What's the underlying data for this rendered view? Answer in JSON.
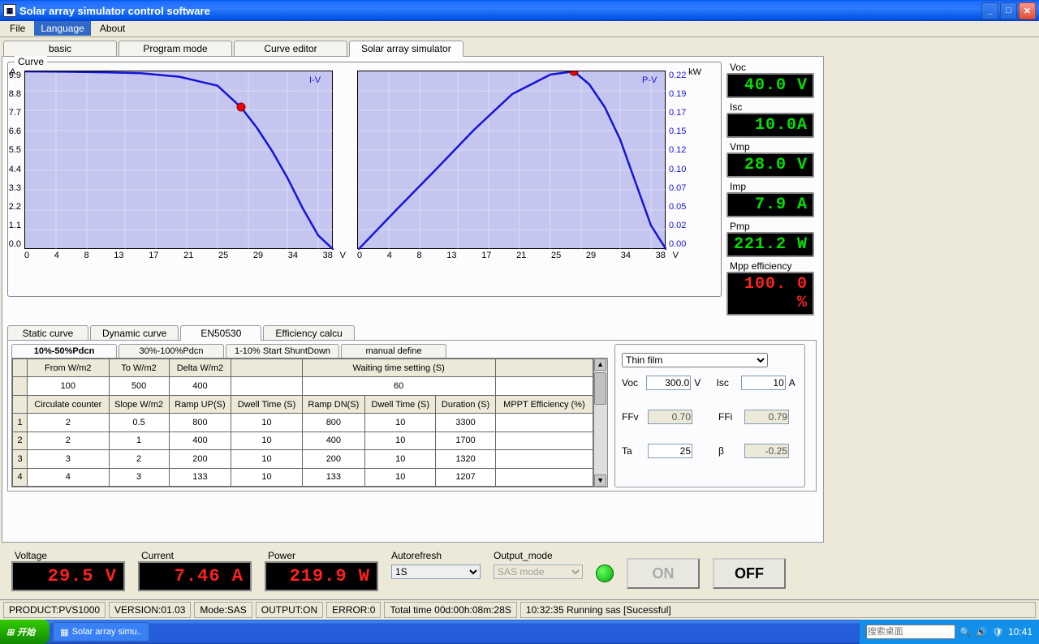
{
  "window": {
    "title": "Solar array simulator control software"
  },
  "menu": {
    "file": "File",
    "language": "Language",
    "about": "About"
  },
  "maintabs": {
    "basic": "basic",
    "program": "Program mode",
    "curve": "Curve editor",
    "sas": "Solar array simulator"
  },
  "curve": {
    "title": "Curve",
    "iv_label": "I-V",
    "pv_label": "P-V",
    "xunit": "V",
    "yunit_iv": "A",
    "yunit_pv": "kW"
  },
  "chart_data": [
    {
      "type": "line",
      "name": "I-V",
      "xlabel": "V",
      "ylabel": "A",
      "xlim": [
        0,
        40
      ],
      "ylim": [
        0,
        9.9
      ],
      "x_ticks": [
        0,
        4,
        8,
        13,
        17,
        21,
        25,
        29,
        34,
        38
      ],
      "y_ticks": [
        0.0,
        1.1,
        2.2,
        3.3,
        4.4,
        5.5,
        6.6,
        7.7,
        8.8,
        9.9
      ],
      "x": [
        0,
        5,
        10,
        15,
        20,
        25,
        28,
        30,
        32,
        34,
        36,
        38,
        40
      ],
      "y": [
        9.9,
        9.88,
        9.85,
        9.8,
        9.6,
        9.1,
        7.9,
        6.8,
        5.5,
        4.0,
        2.3,
        0.8,
        0.0
      ],
      "marker": {
        "x": 28,
        "y": 7.9
      }
    },
    {
      "type": "line",
      "name": "P-V",
      "xlabel": "V",
      "ylabel": "kW",
      "xlim": [
        0,
        40
      ],
      "ylim": [
        0,
        0.22
      ],
      "x_ticks": [
        0,
        4,
        8,
        13,
        17,
        21,
        25,
        29,
        34,
        38
      ],
      "y_ticks": [
        0.0,
        0.02,
        0.05,
        0.07,
        0.1,
        0.12,
        0.15,
        0.17,
        0.19,
        0.22
      ],
      "x": [
        0,
        5,
        10,
        15,
        20,
        25,
        28,
        30,
        32,
        34,
        36,
        38,
        40
      ],
      "y": [
        0.0,
        0.049,
        0.098,
        0.147,
        0.192,
        0.216,
        0.221,
        0.204,
        0.176,
        0.136,
        0.083,
        0.03,
        0.0
      ],
      "marker": {
        "x": 28,
        "y": 0.221
      }
    }
  ],
  "readouts": {
    "voc": {
      "label": "Voc",
      "value": "40.0 V"
    },
    "isc": {
      "label": "Isc",
      "value": "10.0A"
    },
    "vmp": {
      "label": "Vmp",
      "value": "28.0 V"
    },
    "imp": {
      "label": "Imp",
      "value": "7.9 A"
    },
    "pmp": {
      "label": "Pmp",
      "value": "221.2 W"
    },
    "mpp": {
      "label": "Mpp efficiency",
      "value": "100. 0 %"
    }
  },
  "subtabs": {
    "static": "Static curve",
    "dynamic": "Dynamic curve",
    "en": "EN50530",
    "eff": "Efficiency calcu"
  },
  "minitabs": {
    "p1": "10%-50%Pdcn",
    "p2": "30%-100%Pdcn",
    "p3": "1-10% Start ShuntDown",
    "p4": "manual define"
  },
  "table": {
    "h1": {
      "from": "From W/m2",
      "to": "To W/m2",
      "delta": "Delta W/m2",
      "wait": "Waiting time setting (S)"
    },
    "r1": {
      "from": "100",
      "to": "500",
      "delta": "400",
      "wait": "60"
    },
    "h2": {
      "circ": "Circulate counter",
      "slope": "Slope W/m2",
      "rup": "Ramp UP(S)",
      "dwell1": "Dwell Time (S)",
      "rdn": "Ramp DN(S)",
      "dwell2": "Dwell Time (S)",
      "dur": "Duration (S)",
      "mppt": "MPPT Efficiency (%)"
    },
    "rows": [
      {
        "n": "1",
        "circ": "2",
        "slope": "0.5",
        "rup": "800",
        "dwell1": "10",
        "rdn": "800",
        "dwell2": "10",
        "dur": "3300",
        "mppt": ""
      },
      {
        "n": "2",
        "circ": "2",
        "slope": "1",
        "rup": "400",
        "dwell1": "10",
        "rdn": "400",
        "dwell2": "10",
        "dur": "1700",
        "mppt": ""
      },
      {
        "n": "3",
        "circ": "3",
        "slope": "2",
        "rup": "200",
        "dwell1": "10",
        "rdn": "200",
        "dwell2": "10",
        "dur": "1320",
        "mppt": ""
      },
      {
        "n": "4",
        "circ": "4",
        "slope": "3",
        "rup": "133",
        "dwell1": "10",
        "rdn": "133",
        "dwell2": "10",
        "dur": "1207",
        "mppt": ""
      }
    ]
  },
  "params": {
    "tech": "Thin film",
    "voc_l": "Voc",
    "voc": "300.0",
    "voc_u": "V",
    "isc_l": "Isc",
    "isc": "10",
    "isc_u": "A",
    "ffv_l": "FFv",
    "ffv": "0.70",
    "ffi_l": "FFi",
    "ffi": "0.79",
    "ta_l": "Ta",
    "ta": "25",
    "beta_l": "β",
    "beta": "-0.25"
  },
  "meters": {
    "voltage": {
      "label": "Voltage",
      "value": "29.5 V"
    },
    "current": {
      "label": "Current",
      "value": "7.46 A"
    },
    "power": {
      "label": "Power",
      "value": "219.9 W"
    }
  },
  "controls": {
    "autorefresh_l": "Autorefresh",
    "autorefresh": "1S",
    "outmode_l": "Output_mode",
    "outmode": "SAS mode",
    "on": "ON",
    "off": "OFF"
  },
  "status": {
    "product": "PRODUCT:PVS1000",
    "version": "VERSION:01.03",
    "mode": "Mode:SAS",
    "output": "OUTPUT:ON",
    "error": "ERROR:0",
    "total": "Total time 00d:00h:08m:28S",
    "running": "10:32:35 Running sas [Sucessful]"
  },
  "taskbar": {
    "start": "开始",
    "app": "Solar array simu..",
    "search": "搜索桌面",
    "clock": "10:41"
  }
}
